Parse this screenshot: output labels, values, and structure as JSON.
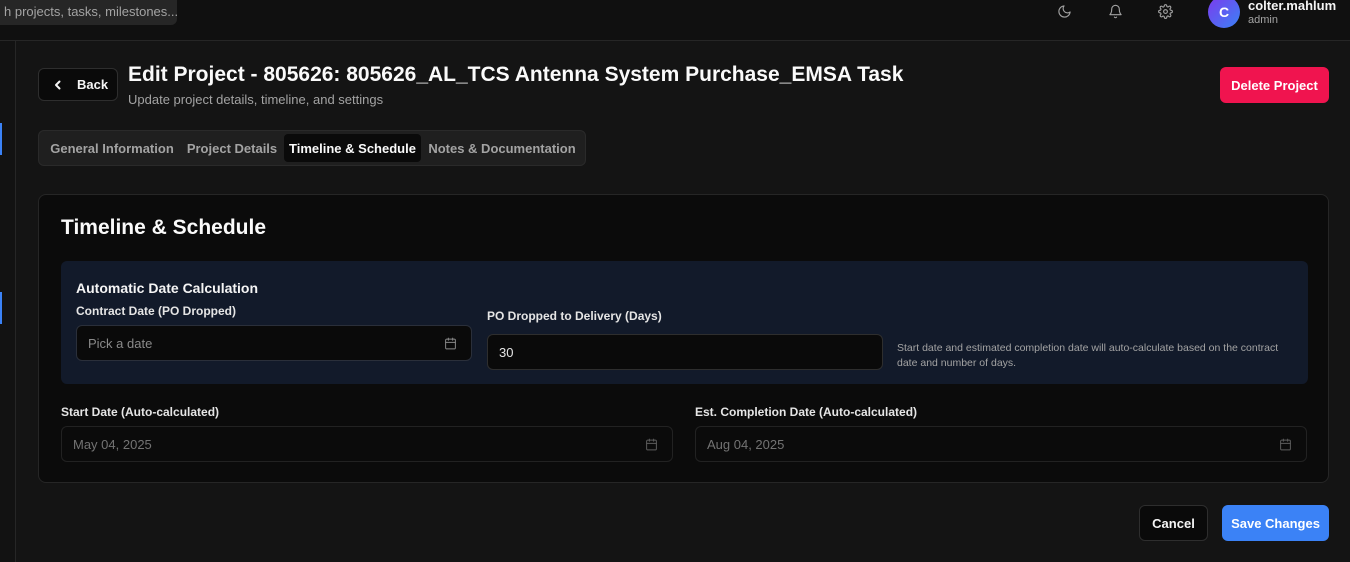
{
  "topbar": {
    "search_placeholder": "h projects, tasks, milestones...",
    "icons": [
      "moon-icon",
      "bell-icon",
      "gear-icon"
    ],
    "user": {
      "initial": "C",
      "name": "colter.mahlum",
      "role": "admin"
    }
  },
  "header": {
    "back_label": "Back",
    "title": "Edit Project - 805626: 805626_AL_TCS Antenna System Purchase_EMSA Task",
    "subtitle": "Update project details, timeline, and settings",
    "delete_label": "Delete Project"
  },
  "tabs": [
    {
      "label": "General Information",
      "active": false
    },
    {
      "label": "Project Details",
      "active": false
    },
    {
      "label": "Timeline & Schedule",
      "active": true
    },
    {
      "label": "Notes & Documentation",
      "active": false
    }
  ],
  "card": {
    "title": "Timeline & Schedule",
    "auto_calc": {
      "title": "Automatic Date Calculation",
      "contract_date_label": "Contract Date (PO Dropped)",
      "contract_date_placeholder": "Pick a date",
      "delivery_days_label": "PO Dropped to Delivery (Days)",
      "delivery_days_value": "30",
      "hint": "Start date and estimated completion date will auto-calculate based on the contract date and number of days."
    },
    "start_date_label": "Start Date (Auto-calculated)",
    "start_date_value": "May 04, 2025",
    "completion_date_label": "Est. Completion Date (Auto-calculated)",
    "completion_date_value": "Aug 04, 2025"
  },
  "footer": {
    "cancel_label": "Cancel",
    "save_label": "Save Changes"
  },
  "colors": {
    "accent": "#3b82f6",
    "danger": "#f0144f",
    "background": "#141414",
    "panel": "#121a2a"
  }
}
